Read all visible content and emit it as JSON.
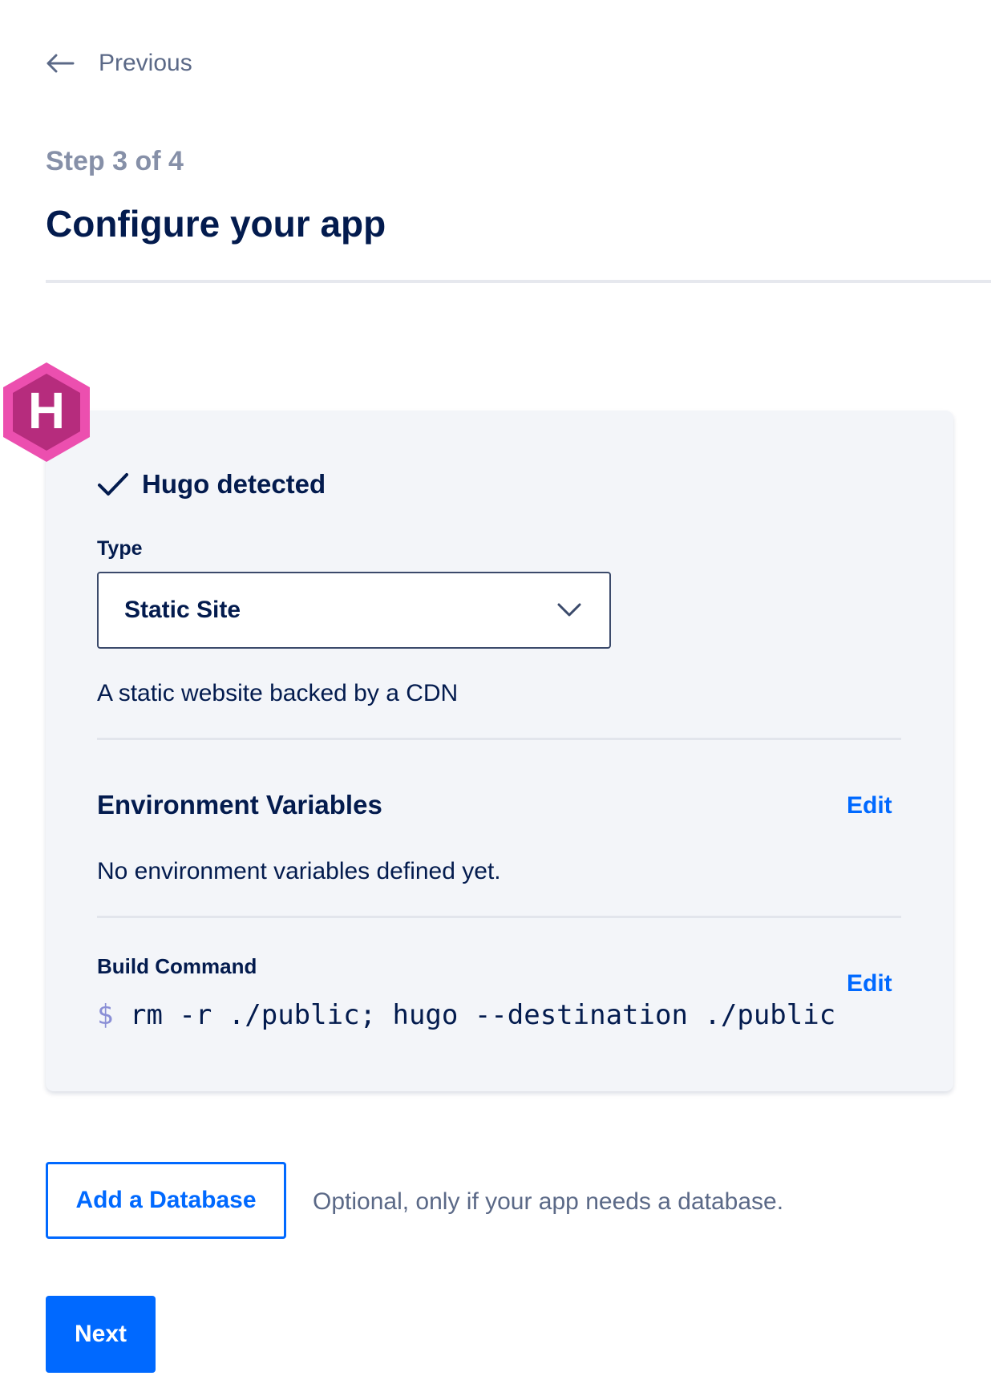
{
  "nav": {
    "previous_label": "Previous"
  },
  "header": {
    "step": "Step 3 of 4",
    "title": "Configure your app"
  },
  "detection": {
    "framework_icon_letter": "H",
    "label": "Hugo detected",
    "icon": "check-icon"
  },
  "type_field": {
    "label": "Type",
    "selected": "Static Site",
    "description": "A static website backed by a CDN"
  },
  "env": {
    "title": "Environment Variables",
    "edit_label": "Edit",
    "empty_text": "No environment variables defined yet."
  },
  "build": {
    "label": "Build Command",
    "edit_label": "Edit",
    "prompt": "$",
    "command": "rm -r ./public; hugo --destination ./public"
  },
  "database": {
    "button_label": "Add a Database",
    "description": "Optional, only if your app needs a database."
  },
  "actions": {
    "next_label": "Next"
  },
  "colors": {
    "accent": "#0069ff",
    "heading": "#031b4e",
    "muted": "#5b6987",
    "hugo_pink": "#ec4faf",
    "hugo_dark": "#b62c7d"
  }
}
